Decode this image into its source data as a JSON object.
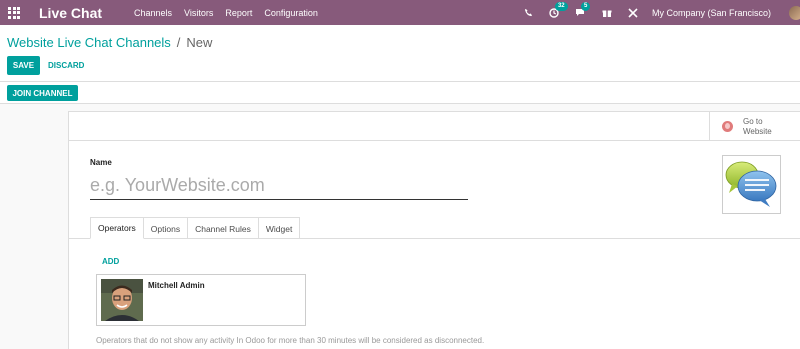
{
  "navbar": {
    "brand": "Live Chat",
    "menu": [
      "Channels",
      "Visitors",
      "Report",
      "Configuration"
    ],
    "messages_count": "32",
    "activities_count": "5",
    "company": "My Company (San Francisco)"
  },
  "breadcrumb": {
    "parent": "Website Live Chat Channels",
    "current": "New"
  },
  "actions": {
    "save": "SAVE",
    "discard": "DISCARD",
    "join": "JOIN CHANNEL"
  },
  "goto_website": {
    "line1": "Go to",
    "line2": "Website"
  },
  "form": {
    "name_label": "Name",
    "name_placeholder": "e.g. YourWebsite.com",
    "name_value": ""
  },
  "tabs": [
    "Operators",
    "Options",
    "Channel Rules",
    "Widget"
  ],
  "operators": {
    "add_label": "ADD",
    "items": [
      {
        "name": "Mitchell Admin"
      }
    ],
    "help": "Operators that do not show any activity In Odoo for more than 30 minutes will be considered as disconnected."
  },
  "colors": {
    "navbar": "#875a7b",
    "accent": "#00a09d"
  }
}
